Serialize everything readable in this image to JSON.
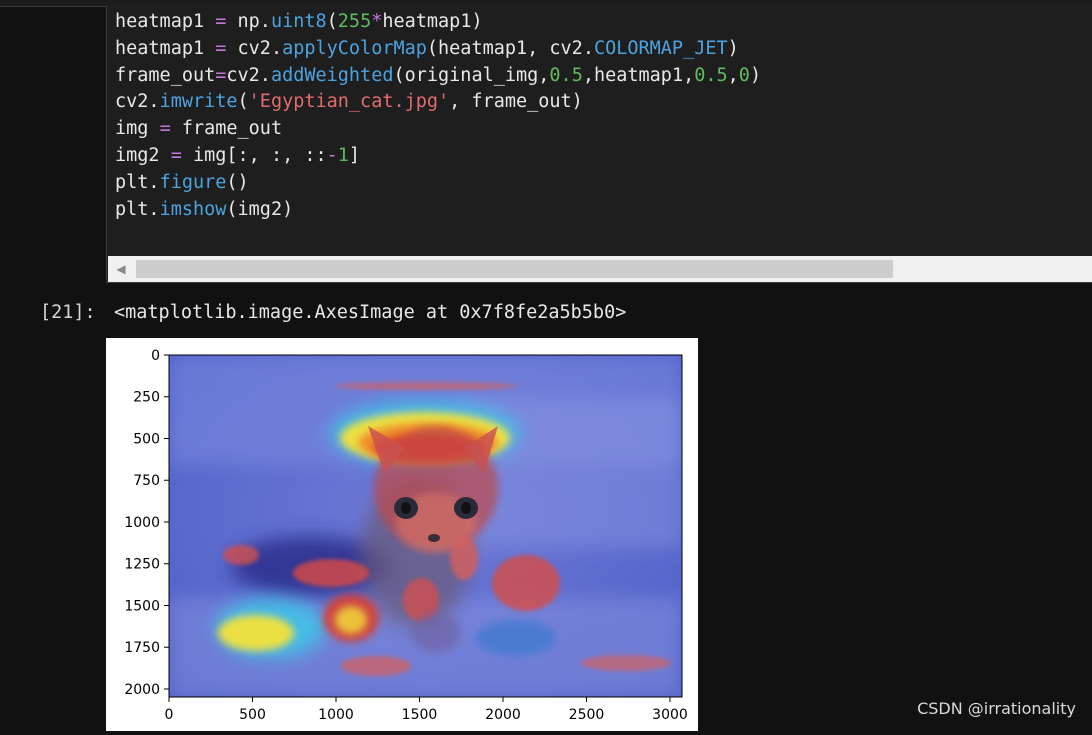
{
  "code_cell": {
    "lines": [
      [
        {
          "t": "heatmap1 ",
          "c": "var"
        },
        {
          "t": "=",
          "c": "op"
        },
        {
          "t": " np.",
          "c": "var"
        },
        {
          "t": "uint8",
          "c": "fn"
        },
        {
          "t": "(",
          "c": "var"
        },
        {
          "t": "255",
          "c": "num"
        },
        {
          "t": "*",
          "c": "op"
        },
        {
          "t": "heatmap1)",
          "c": "var"
        }
      ],
      [
        {
          "t": "heatmap1 ",
          "c": "var"
        },
        {
          "t": "=",
          "c": "op"
        },
        {
          "t": " cv2.",
          "c": "var"
        },
        {
          "t": "applyColorMap",
          "c": "fn"
        },
        {
          "t": "(heatmap1, cv2.",
          "c": "var"
        },
        {
          "t": "COLORMAP_JET",
          "c": "const"
        },
        {
          "t": ")",
          "c": "var"
        }
      ],
      [
        {
          "t": "frame_out",
          "c": "var"
        },
        {
          "t": "=",
          "c": "op"
        },
        {
          "t": "cv2.",
          "c": "var"
        },
        {
          "t": "addWeighted",
          "c": "fn"
        },
        {
          "t": "(original_img,",
          "c": "var"
        },
        {
          "t": "0.5",
          "c": "num"
        },
        {
          "t": ",heatmap1,",
          "c": "var"
        },
        {
          "t": "0.5",
          "c": "num"
        },
        {
          "t": ",",
          "c": "var"
        },
        {
          "t": "0",
          "c": "num"
        },
        {
          "t": ")",
          "c": "var"
        }
      ],
      [
        {
          "t": "cv2.",
          "c": "var"
        },
        {
          "t": "imwrite",
          "c": "fn"
        },
        {
          "t": "(",
          "c": "var"
        },
        {
          "t": "'Egyptian_cat.jpg'",
          "c": "str"
        },
        {
          "t": ", frame_out)",
          "c": "var"
        }
      ],
      [
        {
          "t": "img ",
          "c": "var"
        },
        {
          "t": "=",
          "c": "op"
        },
        {
          "t": " frame_out",
          "c": "var"
        }
      ],
      [
        {
          "t": "img2 ",
          "c": "var"
        },
        {
          "t": "=",
          "c": "op"
        },
        {
          "t": " img[:, :, ::",
          "c": "var"
        },
        {
          "t": "-",
          "c": "op"
        },
        {
          "t": "1",
          "c": "num"
        },
        {
          "t": "]",
          "c": "var"
        }
      ],
      [
        {
          "t": "plt.",
          "c": "var"
        },
        {
          "t": "figure",
          "c": "fn"
        },
        {
          "t": "()",
          "c": "var"
        }
      ],
      [
        {
          "t": "plt.",
          "c": "var"
        },
        {
          "t": "imshow",
          "c": "fn"
        },
        {
          "t": "(img2)",
          "c": "var"
        }
      ]
    ]
  },
  "output": {
    "prompt": "[21]:",
    "text": "<matplotlib.image.AxesImage at 0x7f8fe2a5b5b0>"
  },
  "plot": {
    "image_description_alt": "cat",
    "y_ticks": [
      "0",
      "250",
      "500",
      "750",
      "1000",
      "1250",
      "1500",
      "1750",
      "2000"
    ],
    "x_ticks": [
      "0",
      "500",
      "1000",
      "1500",
      "2000",
      "2500",
      "3000"
    ],
    "y_tick_values": [
      0,
      250,
      500,
      750,
      1000,
      1250,
      1500,
      1750,
      2000
    ],
    "x_tick_values": [
      0,
      500,
      1000,
      1500,
      2000,
      2500,
      3000
    ],
    "x_range": [
      0,
      3072
    ],
    "y_range": [
      2048,
      0
    ]
  },
  "watermark": "CSDN @irrationality",
  "colors": {
    "background": "#111111",
    "cell_background": "#1e1e1e",
    "keyword": "#c678dd",
    "function": "#4ca3e0",
    "number": "#5fbb62",
    "string": "#e06c6c"
  }
}
